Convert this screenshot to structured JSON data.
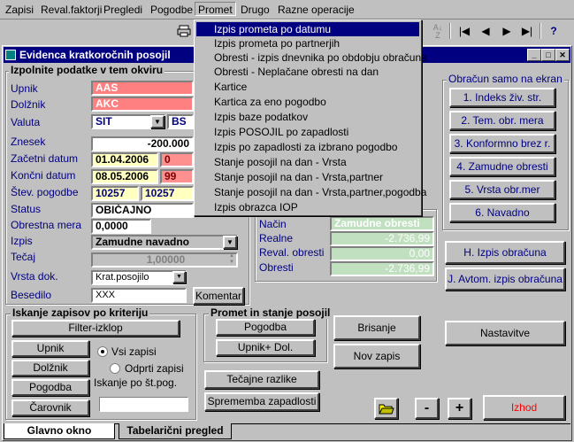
{
  "menubar": [
    "Zapisi",
    "Reval.faktorji",
    "Pregledi",
    "Pogodbe",
    "Promet",
    "Drugo",
    "Razne operacije"
  ],
  "toolbar": {
    "icons": [
      "print-icon",
      "sort-icon",
      "first-record-icon",
      "prev-record-icon",
      "next-record-icon",
      "last-record-icon",
      "help-icon"
    ],
    "help": "?"
  },
  "window": {
    "title": "Evidenca kratkoročnih posojil",
    "btn_min": "_",
    "btn_max": "□",
    "btn_close": "✕"
  },
  "promet_menu": [
    "Izpis prometa po datumu",
    "Izpis prometa po partnerjih",
    "Obresti - izpis dnevnika po obdobju obračuna",
    "Obresti - Neplačane obresti na dan",
    "Kartice",
    "Kartica za eno pogodbo",
    "Izpis baze podatkov",
    "Izpis POSOJIL po zapadlosti",
    "Izpis po zapadlosti za izbrano pogodbo",
    "Stanje posojil na dan - Vrsta",
    "Stanje posojil na dan - Vrsta,partner",
    "Stanje posojil na dan - Vrsta,partner,pogodba",
    "Izpis obrazca IOP"
  ],
  "form": {
    "group_title": "Izpolnite podatke v tem okviru",
    "upnik_label": "Upnik",
    "upnik": "AAS",
    "dolznik_label": "Dolžnik",
    "dolznik": "AKC",
    "valuta_label": "Valuta",
    "valuta": "SIT",
    "valuta2": "BS",
    "znesek_label": "Znesek",
    "znesek": "-200.000",
    "zacetni_label": "Začetni datum",
    "zacetni": "01.04.2006",
    "zacetni_n": "0",
    "koncni_label": "Končni datum",
    "koncni": "08.05.2006",
    "koncni_n": "99",
    "stev_label": "Štev. pogodbe",
    "stev": "10257",
    "stev2": "10257",
    "status_label": "Status",
    "status": "OBIČAJNO",
    "obrestna_label": "Obrestna mera",
    "obrestna": "0,0000",
    "izpis_label": "Izpis",
    "izpis": "Zamudne navadno",
    "tecaj_label": "Tečaj",
    "tecaj": "1,00000",
    "vrsta_label": "Vrsta dok.",
    "vrsta": "Krat.posojilo",
    "besedilo_label": "Besedilo",
    "besedilo": "XXX",
    "komentar": "Komentar"
  },
  "calc": {
    "nacin_label": "Način",
    "nacin": "Zamudne obresti",
    "realne_label": "Realne",
    "realne": "-2.736,99",
    "reval_label": "Reval. obresti",
    "reval": "0,00",
    "obresti_label": "Obresti",
    "obresti": "-2.736,99"
  },
  "obracun": {
    "title": "Obračun  samo na ekran",
    "buttons": [
      "1. Indeks živ. str.",
      "2. Tem. obr. mera",
      "3. Konformno brez r.",
      "4. Zamudne obresti",
      "5. Vrsta obr.mer",
      "6. Navadno"
    ]
  },
  "izpis_obracuna": "H. Izpis obračuna",
  "avtom_izpis": "J. Avtom. izpis obračuna",
  "iskanje": {
    "title": "Iskanje zapisov po kriteriju",
    "filter": "Filter-izklop",
    "upnik": "Upnik",
    "dolznik": "Dolžnik",
    "pogodba": "Pogodba",
    "carovnik": "Čarovnik",
    "vsi": "Vsi zapisi",
    "odprti": "Odprti zapisi",
    "po_st": "Iskanje po št.pog.",
    "search_value": ""
  },
  "promet_stanje": {
    "title": "Promet in stanje posojil",
    "pogodba": "Pogodba",
    "upnik_dol": "Upnik+ Dol."
  },
  "tecajne": "Tečajne razlike",
  "sprememba": "Sprememba zapadlosti",
  "brisanje": "Brisanje",
  "nov_zapis": "Nov zapis",
  "nastavitve": "Nastavitve",
  "minus": "-",
  "plus": "+",
  "izhod": "Izhod",
  "tabs": [
    "Glavno okno",
    "Tabelarični pregled"
  ],
  "colors": {
    "title_bar": "#000080",
    "highlight_field": "#ff8080",
    "date_field": "#ffff80",
    "link_text": "#000080",
    "izhod_text": "#ff0000"
  }
}
